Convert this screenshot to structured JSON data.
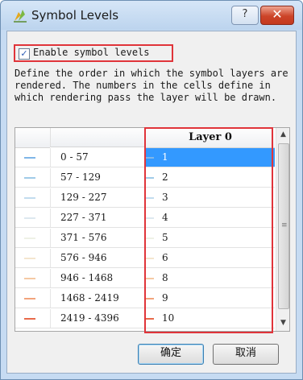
{
  "window": {
    "title": "Symbol Levels",
    "help_label": "?",
    "close_label": "✕"
  },
  "enable": {
    "checked": true,
    "check_glyph": "✓",
    "label": "Enable symbol levels"
  },
  "description": "Define the order in which the symbol layers are rendered. The numbers in the cells define in which rendering pass the layer will be drawn.",
  "table": {
    "header": "Layer 0",
    "selected_row": 0,
    "rows": [
      {
        "range": "0 - 57",
        "level": "1",
        "color": "#7fb6e8"
      },
      {
        "range": "57 - 129",
        "level": "2",
        "color": "#a0cbe8"
      },
      {
        "range": "129 - 227",
        "level": "3",
        "color": "#c2dcee"
      },
      {
        "range": "227 - 371",
        "level": "4",
        "color": "#dde8ef"
      },
      {
        "range": "371 - 576",
        "level": "5",
        "color": "#eef1e6"
      },
      {
        "range": "576 - 946",
        "level": "6",
        "color": "#f4e6cf"
      },
      {
        "range": "946 - 1468",
        "level": "8",
        "color": "#f5c9a4"
      },
      {
        "range": "1468 - 2419",
        "level": "9",
        "color": "#f2a47c"
      },
      {
        "range": "2419 - 4396",
        "level": "10",
        "color": "#e86a4a"
      }
    ]
  },
  "buttons": {
    "ok": "确定",
    "cancel": "取消"
  }
}
